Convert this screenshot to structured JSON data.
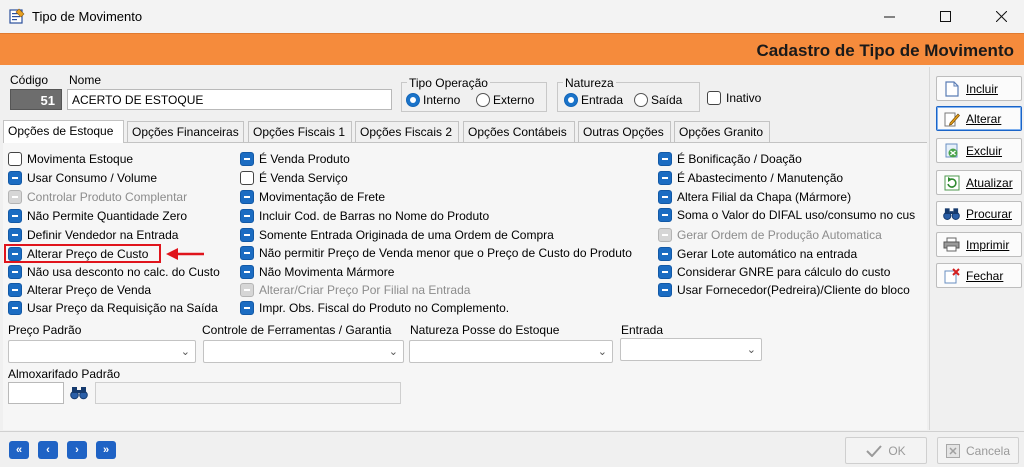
{
  "window": {
    "title": "Tipo de Movimento"
  },
  "header": {
    "title": "Cadastro de Tipo de Movimento"
  },
  "fields": {
    "codigo_label": "Código",
    "codigo_value": "51",
    "nome_label": "Nome",
    "nome_value": "ACERTO DE ESTOQUE",
    "tipo_operacao": {
      "label": "Tipo Operação",
      "options": [
        "Interno",
        "Externo"
      ],
      "selected": "Interno"
    },
    "natureza": {
      "label": "Natureza",
      "options": [
        "Entrada",
        "Saída"
      ],
      "selected": "Entrada"
    },
    "inativo_label": "Inativo"
  },
  "tabs": [
    "Opções de Estoque",
    "Opções Financeiras",
    "Opções Fiscais 1",
    "Opções Fiscais 2",
    "Opções Contábeis",
    "Outras Opções",
    "Opções Granito"
  ],
  "active_tab": "Opções de Estoque",
  "col1": [
    {
      "label": "Movimenta Estoque",
      "state": "off"
    },
    {
      "label": "Usar Consumo / Volume",
      "state": "on"
    },
    {
      "label": "Controlar Produto Complentar",
      "state": "disabled"
    },
    {
      "label": "Não Permite Quantidade Zero",
      "state": "on"
    },
    {
      "label": "Definir Vendedor na Entrada",
      "state": "on"
    },
    {
      "label": "Alterar Preço de Custo",
      "state": "on"
    },
    {
      "label": "Não usa desconto no calc. do Custo",
      "state": "on"
    },
    {
      "label": "Alterar Preço de Venda",
      "state": "on"
    },
    {
      "label": "Usar Preço da Requisição na Saída",
      "state": "on"
    }
  ],
  "col2": [
    {
      "label": "É Venda Produto",
      "state": "on"
    },
    {
      "label": "É Venda Serviço",
      "state": "off"
    },
    {
      "label": "Movimentação de Frete",
      "state": "on"
    },
    {
      "label": "Incluir Cod. de Barras no Nome do Produto",
      "state": "on"
    },
    {
      "label": "Somente Entrada Originada de uma Ordem de Compra",
      "state": "on"
    },
    {
      "label": "Não permitir Preço de Venda menor que o Preço de Custo do Produto",
      "state": "on"
    },
    {
      "label": "Não Movimenta Mármore",
      "state": "on"
    },
    {
      "label": "Alterar/Criar Preço Por Filial na Entrada",
      "state": "disabled"
    },
    {
      "label": "Impr. Obs. Fiscal do Produto no Complemento.",
      "state": "on"
    }
  ],
  "col3": [
    {
      "label": "É Bonificação / Doação",
      "state": "on"
    },
    {
      "label": "É Abastecimento / Manutenção",
      "state": "on"
    },
    {
      "label": "Altera Filial da Chapa (Mármore)",
      "state": "on"
    },
    {
      "label": "Soma o Valor do DIFAL uso/consumo no cus",
      "state": "on"
    },
    {
      "label": "Gerar Ordem de Produção Automatica",
      "state": "disabled"
    },
    {
      "label": "Gerar Lote automático na entrada",
      "state": "on"
    },
    {
      "label": "Considerar GNRE para cálculo do custo",
      "state": "on"
    },
    {
      "label": "Usar Fornecedor(Pedreira)/Cliente do bloco",
      "state": "on"
    }
  ],
  "dropdowns": [
    {
      "label": "Preço Padrão",
      "value": ""
    },
    {
      "label": "Controle de Ferramentas / Garantia",
      "value": ""
    },
    {
      "label": "Natureza Posse do Estoque",
      "value": ""
    },
    {
      "label": "Entrada",
      "value": ""
    }
  ],
  "almoxarifado": {
    "label": "Almoxarifado Padrão",
    "code": "",
    "name": ""
  },
  "side_buttons": [
    "Incluir",
    "Alterar",
    "Excluir",
    "Atualizar",
    "Procurar",
    "Imprimir",
    "Fechar"
  ],
  "bottom": {
    "ok_label": "OK",
    "cancel_label": "Cancela"
  },
  "colors": {
    "accent_orange": "#f58b3c",
    "check_blue": "#1b6cc2",
    "highlight_red": "#e0141c"
  }
}
